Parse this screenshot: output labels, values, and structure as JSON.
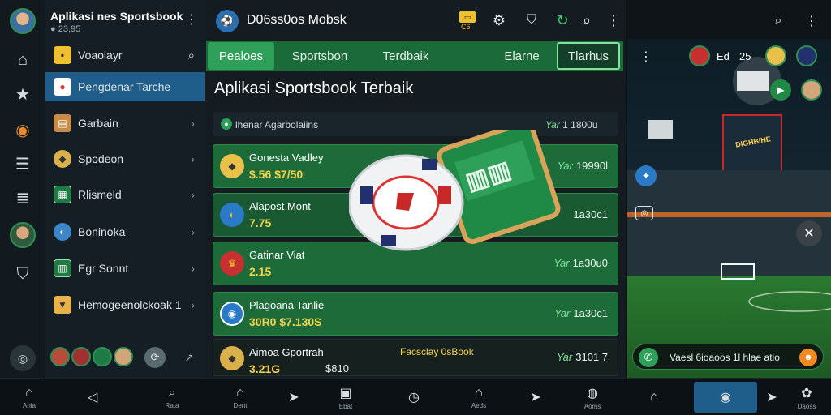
{
  "app": {
    "title": "Aplikasi nes Sportsbook",
    "subtitle": "23,95"
  },
  "menu": {
    "items": [
      {
        "label": "Voaolayr"
      },
      {
        "label": "Pengdenar Tarche"
      },
      {
        "label": "Garbain"
      },
      {
        "label": "Spodeon"
      },
      {
        "label": "Rlismeld"
      },
      {
        "label": "Boninoka"
      },
      {
        "label": "Egr Sonnt"
      },
      {
        "label": "Hemogeenolckoak  1"
      }
    ]
  },
  "header": {
    "title": "D06ss0os Mobsk",
    "badge": "C6"
  },
  "tabs": [
    {
      "label": "Pealoes"
    },
    {
      "label": "Sportsbon"
    },
    {
      "label": "Terdbaik"
    },
    {
      "label": "Elarne"
    },
    {
      "label": "Tlarhus"
    }
  ],
  "main": {
    "heading": "Aplikasi Sportsbook Terbaik",
    "filter": {
      "label": "lhenar Agarbolaiins",
      "prefix": "Yar",
      "value": "1 1800u"
    },
    "promo": "Facsclay 0sBook",
    "matches": [
      {
        "name": "Gonesta Vadley",
        "odds": "$.56  $7/50",
        "prefix": "Yar",
        "time": "19990l"
      },
      {
        "name": "Alapost Mont",
        "odds": "7.75",
        "prefix": "",
        "time": "1a30c1"
      },
      {
        "name": "Gatinar Viat",
        "odds": "2.15",
        "prefix": "Yar",
        "time": "1a30u0"
      },
      {
        "name": "Plagoana Tanlie",
        "odds": "30R0  $7.130S",
        "prefix": "Yar",
        "time": "1a30c1"
      },
      {
        "name": "Aimoa Gportrah",
        "odds": "3.21G",
        "extra": "$810",
        "prefix": "Yar",
        "time": "3101 7"
      }
    ]
  },
  "stadium": {
    "scores": [
      "Ed",
      "25"
    ],
    "board": "DIGHBIHE",
    "chat": "Vaesl 6ioaoos 1l hlae atio"
  },
  "navbar": [
    {
      "label": "Ahia"
    },
    {
      "label": ""
    },
    {
      "label": "Rata"
    },
    {
      "label": "Dent"
    },
    {
      "label": ""
    },
    {
      "label": "Ebat"
    },
    {
      "label": ""
    },
    {
      "label": "Aeds"
    },
    {
      "label": ""
    },
    {
      "label": "Aoms"
    },
    {
      "label": ""
    },
    {
      "label": ""
    },
    {
      "label": "Daoss"
    }
  ],
  "colors": {
    "accent": "#1f8a45",
    "active_menu": "#1f5d8a",
    "odds": "#f3d34a"
  }
}
